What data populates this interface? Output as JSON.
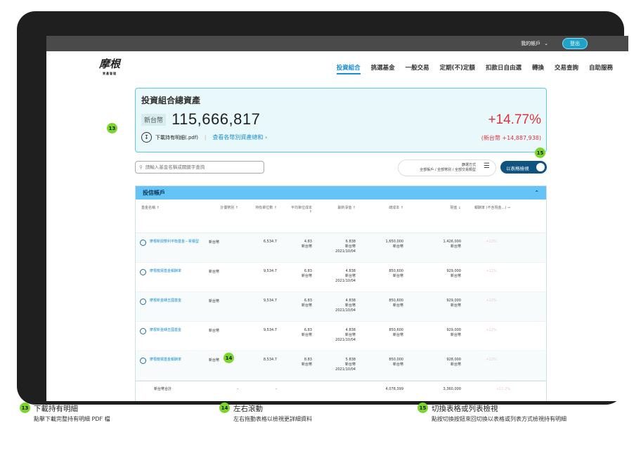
{
  "topbar": {
    "account_label": "我的帳戶",
    "logout_label": "登出"
  },
  "logo": {
    "name": "摩根",
    "sub": "資產管理"
  },
  "nav": {
    "items": [
      "投資組合",
      "挑選基金",
      "一般交易",
      "定期(不)定額",
      "扣款日自由選",
      "轉換",
      "交易查詢",
      "自助服務"
    ],
    "active": 0
  },
  "summary": {
    "title": "投資組合總資產",
    "currency": "新台幣",
    "total": "115,666,817",
    "return_pct": "+14.77%",
    "gain": "(新台幣 +14,887,938)",
    "download_label": "下載持有明細(.pdf)",
    "view_by_currency_label": "查看各幣別資產總和"
  },
  "search": {
    "placeholder": "請輸入基金名稱或關鍵字查詢"
  },
  "filter": {
    "title": "篩選方式",
    "value": "全部帳戶 / 全部幣別 / 全部交易類型"
  },
  "view_toggle": {
    "label": "以表格檢視"
  },
  "table": {
    "title": "投信帳戶",
    "columns": [
      "基金名稱",
      "計價幣別",
      "持有單位數",
      "平均單位成本",
      "最新淨值",
      "總成本",
      "現值",
      "報酬率 (不含現金...)"
    ],
    "rows": [
      {
        "name": "摩根新興雙利平衡基金－累積型",
        "currency": "新台幣",
        "units": "6,534.7",
        "avg_cost": "4.83",
        "avg_cost_cur": "新台幣",
        "nav": "6.838",
        "nav_cur": "新台幣",
        "nav_date": "2021/10/04",
        "cost": "1,650,000",
        "cost_cur": "新台幣",
        "value": "1,426,000",
        "value_cur": "新台幣",
        "ret": "+12%"
      },
      {
        "name": "摩根龍揚基金報酬率",
        "currency": "新台幣",
        "units": "9,534.7",
        "avg_cost": "6.83",
        "avg_cost_cur": "新台幣",
        "nav": "4.838",
        "nav_cur": "新台幣",
        "nav_date": "2021/10/04",
        "cost": "850,600",
        "cost_cur": "新台幣",
        "value": "929,000",
        "value_cur": "新台幣",
        "ret": "+12%"
      },
      {
        "name": "摩根新金磚五國基金",
        "currency": "新台幣",
        "units": "9,534.7",
        "avg_cost": "6.83",
        "avg_cost_cur": "新台幣",
        "nav": "4.838",
        "nav_cur": "新台幣",
        "nav_date": "2021/10/04",
        "cost": "850,600",
        "cost_cur": "新台幣",
        "value": "929,000",
        "value_cur": "新台幣",
        "ret": "+12%"
      },
      {
        "name": "摩根新金磚五國基金",
        "currency": "新台幣",
        "units": "9,534.7",
        "avg_cost": "6.83",
        "avg_cost_cur": "新台幣",
        "nav": "4.838",
        "nav_cur": "新台幣",
        "nav_date": "2021/10/04",
        "cost": "850,600",
        "cost_cur": "新台幣",
        "value": "929,000",
        "value_cur": "新台幣",
        "ret": "+12%"
      },
      {
        "name": "摩根龍揚基金報酬率",
        "currency": "新台幣",
        "units": "8,534.7",
        "avg_cost": "8.83",
        "avg_cost_cur": "新台幣",
        "nav": "5.838",
        "nav_cur": "新台幣",
        "nav_date": "2021/10/04",
        "cost": "850,000",
        "cost_cur": "新台幣",
        "value": "928,000",
        "value_cur": "新台幣",
        "ret": "+12%"
      }
    ],
    "total_row": {
      "label": "新台幣合計",
      "currency": "-",
      "units": "-",
      "cost": "4,078,399",
      "value": "3,360,000",
      "ret": "+11.2%"
    }
  },
  "callouts": [
    {
      "num": "13",
      "title": "下載持有明細",
      "desc": "點擊下載完整持有明細 PDF 檔"
    },
    {
      "num": "14",
      "title": "左右滾動",
      "desc": "左右拖動表格以檢視更詳細資料"
    },
    {
      "num": "15",
      "title": "切換表格或列表檢視",
      "desc": "點按切換按鈕來回切換以表格或列表方式檢視持有明細"
    }
  ]
}
